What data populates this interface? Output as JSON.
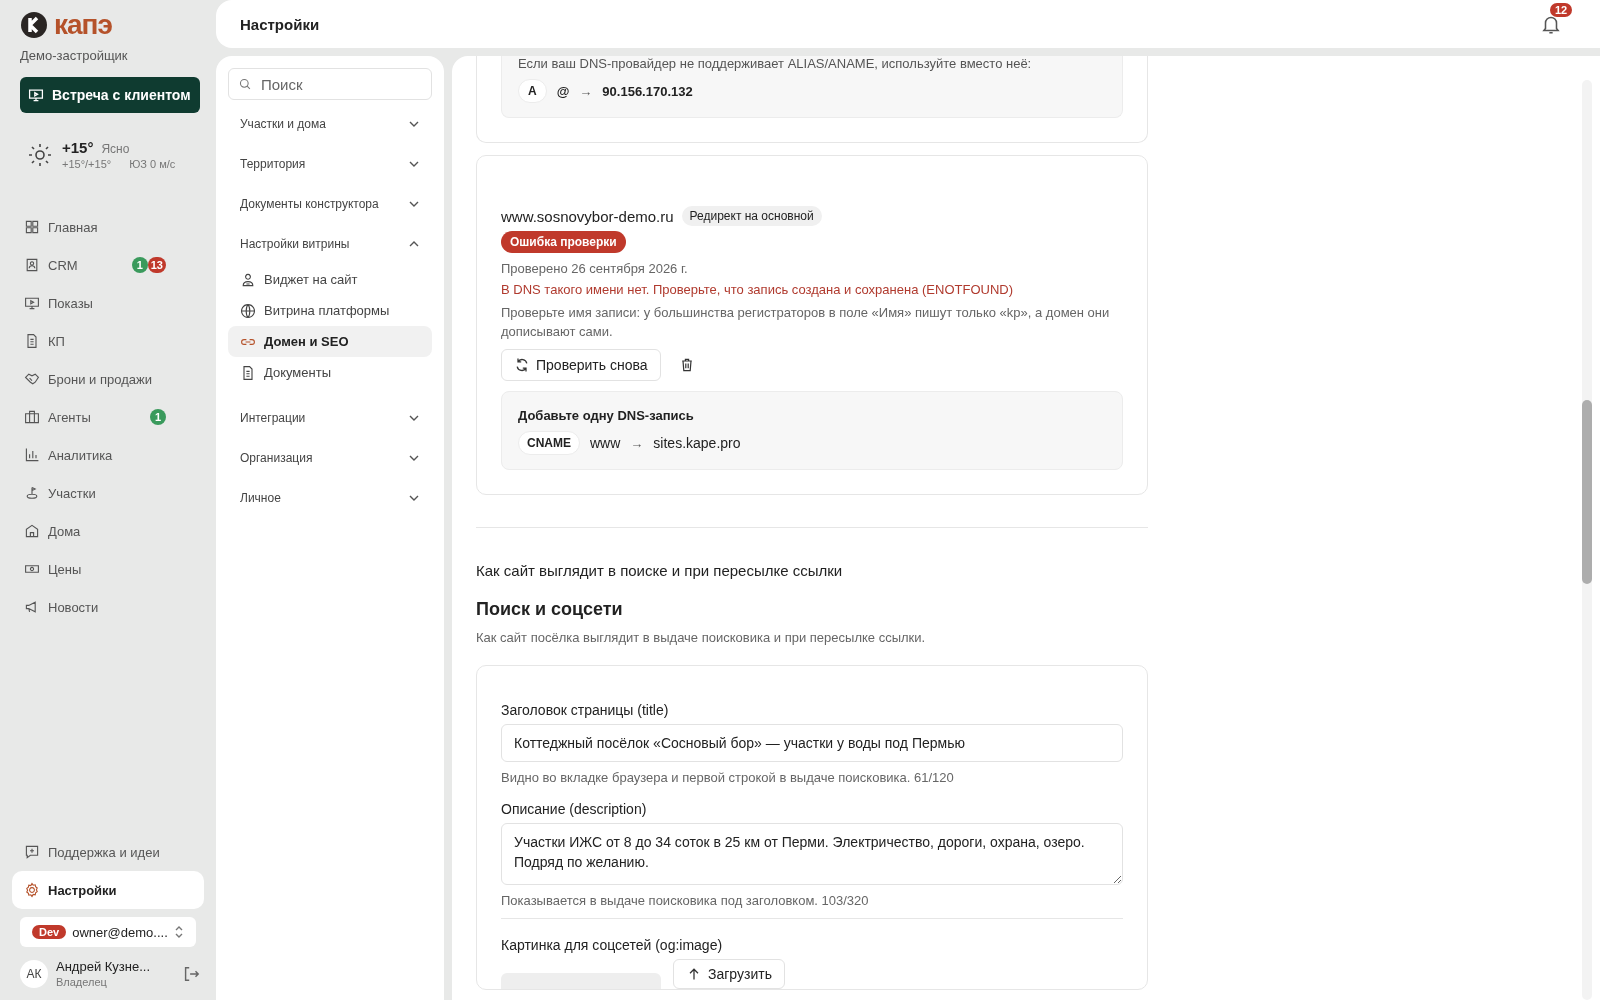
{
  "brand": {
    "logo": "капэ",
    "org": "Демо-застройщик",
    "meeting_button": "Встреча с клиентом"
  },
  "weather": {
    "temp": "+15°",
    "condition": "Ясно",
    "range": "+15°/+15°",
    "wind": "ЮЗ 0 м/с"
  },
  "nav": [
    {
      "label": "Главная",
      "selected": false
    },
    {
      "label": "CRM",
      "selected": false,
      "badges": [
        {
          "text": "1",
          "color": "#3a9a5c"
        },
        {
          "text": "13",
          "color": "#c0392b"
        }
      ]
    },
    {
      "label": "Показы",
      "selected": false
    },
    {
      "label": "КП",
      "selected": false
    },
    {
      "label": "Брони и продажи",
      "selected": false
    },
    {
      "label": "Агенты",
      "selected": false,
      "badges": [
        {
          "text": "1",
          "color": "#3a9a5c"
        }
      ]
    },
    {
      "label": "Аналитика",
      "selected": false
    },
    {
      "label": "Участки",
      "selected": false
    },
    {
      "label": "Дома",
      "selected": false
    },
    {
      "label": "Цены",
      "selected": false
    },
    {
      "label": "Новости",
      "selected": false
    }
  ],
  "footer_nav": [
    {
      "label": "Поддержка и идеи",
      "selected": false
    },
    {
      "label": "Настройки",
      "selected": true
    }
  ],
  "account": {
    "env": "Dev",
    "email": "owner@demo....",
    "initials": "АК",
    "name": "Андрей Кузне...",
    "role": "Владелец"
  },
  "header": {
    "title": "Настройки",
    "notifications": "12"
  },
  "settings_nav": {
    "search_placeholder": "Поиск",
    "groups": [
      {
        "label": "Участки и дома",
        "expanded": false
      },
      {
        "label": "Территория",
        "expanded": false
      },
      {
        "label": "Документы конструктора",
        "expanded": false
      },
      {
        "label": "Настройки витрины",
        "expanded": true,
        "children": [
          {
            "label": "Виджет на сайт",
            "selected": false
          },
          {
            "label": "Витрина платформы",
            "selected": false
          },
          {
            "label": "Домен и SEO",
            "selected": true
          },
          {
            "label": "Документы",
            "selected": false
          }
        ]
      },
      {
        "label": "Интеграции",
        "expanded": false
      },
      {
        "label": "Организация",
        "expanded": false
      },
      {
        "label": "Личное",
        "expanded": false
      }
    ]
  },
  "prev_card": {
    "note": "Если ваш DNS-провайдер не поддерживает ALIAS/ANAME, используйте вместо неё:",
    "record": {
      "type": "A",
      "name": "@",
      "arrow": "→",
      "value": "90.156.170.132"
    }
  },
  "domain_card": {
    "domain": "www.sosnovybor-demo.ru",
    "tag": "Редирект на основной",
    "status": {
      "label": "Ошибка проверки",
      "kind": "error"
    },
    "checked": "Проверено 26 сентября 2026 г.",
    "error": "В DNS такого имени нет. Проверьте, что запись создана и сохранена (ENOTFOUND)",
    "hint": "Проверьте имя записи: у большинства регистраторов в поле «Имя» пишут только «kp», а домен они дописывают сами.",
    "recheck_button": "Проверить снова",
    "dns": {
      "title": "Добавьте одну DNS-запись",
      "record": {
        "type": "CNAME",
        "name": "www",
        "arrow": "→",
        "value": "sites.kape.pro"
      }
    }
  },
  "seo": {
    "caption": "Как сайт выглядит в поиске и при пересылке ссылки",
    "heading": "Поиск и соцсети",
    "subtitle": "Как сайт посёлка выглядит в выдаче поисковика и при пересылке ссылки.",
    "title_field": {
      "label": "Заголовок страницы (title)",
      "value": "Коттеджный посёлок «Сосновый бор» — участки у воды под Пермью",
      "hint": "Видно во вкладке браузера и первой строкой в выдаче поисковика. 61/120"
    },
    "description_field": {
      "label": "Описание (description)",
      "value": "Участки ИЖС от 8 до 34 соток в 25 км от Перми. Электричество, дороги, охрана, озеро. Подряд по желанию.",
      "hint": "Показывается в выдаче поисковика под заголовком. 103/320"
    },
    "image_field": {
      "label": "Картинка для соцсетей (og:image)",
      "upload_button": "Загрузить"
    }
  }
}
